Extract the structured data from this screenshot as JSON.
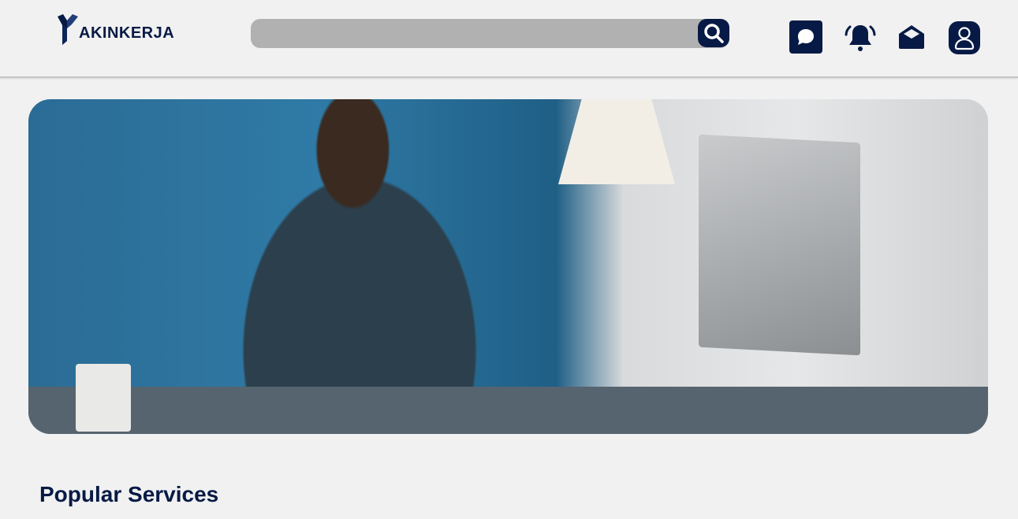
{
  "header": {
    "logo_text": "AKINKERJA",
    "search": {
      "placeholder": "",
      "value": ""
    },
    "icons": [
      "search-icon",
      "chat-icon",
      "bell-icon",
      "mail-icon",
      "user-icon"
    ]
  },
  "hero": {
    "image": "man-with-headphones-working-at-computer"
  },
  "main": {
    "section_title": "Popular Services"
  },
  "colors": {
    "brand": "#071a45",
    "search_bg": "#b1b1b1",
    "background": "#f1f1f1"
  }
}
